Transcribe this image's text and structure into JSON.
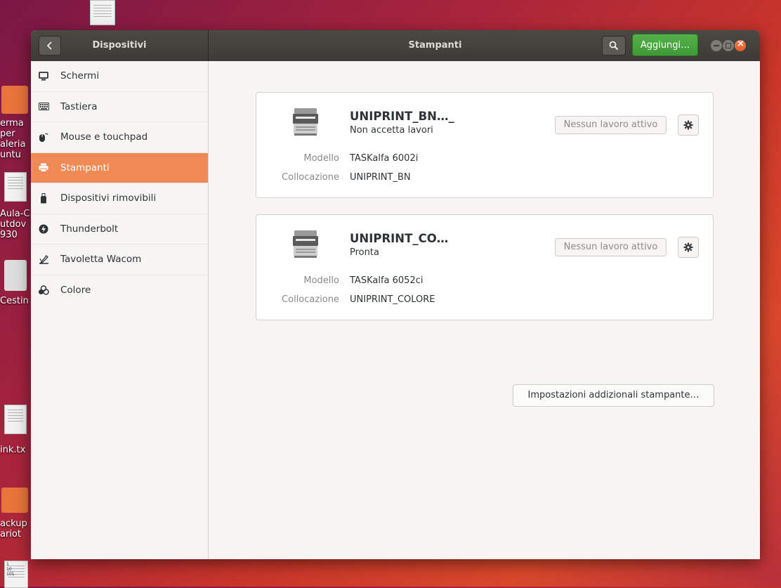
{
  "desktop": {
    "icons": [
      {
        "name": "document",
        "label": ""
      },
      {
        "name": "folder",
        "label": "erma\nper\naleria\nuntu"
      },
      {
        "name": "document",
        "label": "Aula-C\nutdov\n930"
      },
      {
        "name": "trash",
        "label": "Cestin"
      },
      {
        "name": "document",
        "label": "ink.tx"
      },
      {
        "name": "folder",
        "label": "ackup\nariot"
      },
      {
        "name": "document",
        "label": "1\n10\n101"
      }
    ]
  },
  "window": {
    "sidebar_title": "Dispositivi",
    "page_title": "Stampanti",
    "add_label": "Aggiungi…"
  },
  "sidebar": {
    "items": [
      {
        "label": "Schermi",
        "icon": "display-icon"
      },
      {
        "label": "Tastiera",
        "icon": "keyboard-icon"
      },
      {
        "label": "Mouse e touchpad",
        "icon": "mouse-icon"
      },
      {
        "label": "Stampanti",
        "icon": "printer-icon"
      },
      {
        "label": "Dispositivi rimovibili",
        "icon": "usb-icon"
      },
      {
        "label": "Thunderbolt",
        "icon": "thunderbolt-icon"
      },
      {
        "label": "Tavoletta Wacom",
        "icon": "tablet-icon"
      },
      {
        "label": "Colore",
        "icon": "color-icon"
      }
    ]
  },
  "printers": [
    {
      "name": "UNIPRINT_BN…_",
      "status": "Non accetta lavori",
      "jobs_label": "Nessun lavoro attivo",
      "model_label": "Modello",
      "model": "TASKalfa 6002i",
      "location_label": "Collocazione",
      "location": "UNIPRINT_BN"
    },
    {
      "name": "UNIPRINT_CO…",
      "status": "Pronta",
      "jobs_label": "Nessun lavoro attivo",
      "model_label": "Modello",
      "model": "TASKalfa 6052ci",
      "location_label": "Collocazione",
      "location": "UNIPRINT_COLORE"
    }
  ],
  "extra_settings_label": "Impostazioni addizionali stampante…",
  "colors": {
    "accent": "#f08a55",
    "add_button": "#4aa640",
    "titlebar": "#3c3b37"
  }
}
